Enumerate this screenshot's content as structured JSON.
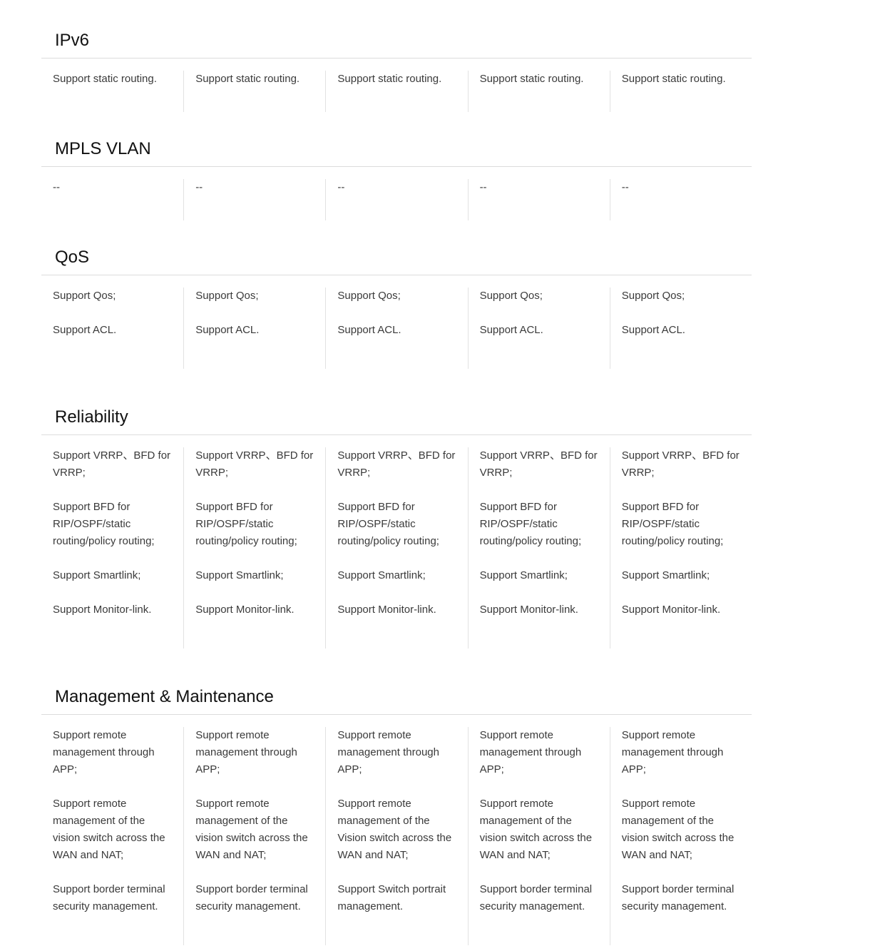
{
  "sections": [
    {
      "title": "IPv6",
      "columns": [
        [
          "Support static routing."
        ],
        [
          "Support static routing."
        ],
        [
          "Support static routing."
        ],
        [
          "Support static routing."
        ],
        [
          "Support static routing."
        ]
      ]
    },
    {
      "title": "MPLS VLAN",
      "columns": [
        [
          "--"
        ],
        [
          "--"
        ],
        [
          "--"
        ],
        [
          "--"
        ],
        [
          "--"
        ]
      ]
    },
    {
      "title": "QoS",
      "columns": [
        [
          "Support Qos;",
          "Support ACL."
        ],
        [
          "Support Qos;",
          "Support ACL."
        ],
        [
          "Support Qos;",
          "Support ACL."
        ],
        [
          "Support Qos;",
          "Support ACL."
        ],
        [
          "Support Qos;",
          "Support ACL."
        ]
      ]
    },
    {
      "title": "Reliability",
      "columns": [
        [
          "Support VRRP、BFD for VRRP;",
          "Support BFD for RIP/OSPF/static routing/policy routing;",
          "Support Smartlink;",
          "Support Monitor-link."
        ],
        [
          "Support VRRP、BFD for VRRP;",
          "Support BFD for RIP/OSPF/static routing/policy routing;",
          "Support Smartlink;",
          "Support Monitor-link."
        ],
        [
          "Support VRRP、BFD for VRRP;",
          "Support BFD for RIP/OSPF/static routing/policy routing;",
          "Support Smartlink;",
          "Support Monitor-link."
        ],
        [
          "Support VRRP、BFD for VRRP;",
          "Support BFD for RIP/OSPF/static routing/policy routing;",
          "Support Smartlink;",
          "Support Monitor-link."
        ],
        [
          "Support VRRP、BFD for VRRP;",
          "Support BFD for RIP/OSPF/static routing/policy routing;",
          "Support Smartlink;",
          "Support Monitor-link."
        ]
      ]
    },
    {
      "title": "Management & Maintenance",
      "columns": [
        [
          "Support remote management through APP;",
          "Support remote management of the vision switch across the WAN and NAT;",
          "Support border terminal security management."
        ],
        [
          "Support remote management through APP;",
          "Support remote management of the vision switch across the WAN and NAT;",
          "Support border terminal security management."
        ],
        [
          "Support remote management through APP;",
          "Support remote management of the Vision switch across the WAN and NAT;",
          "Support Switch portrait management."
        ],
        [
          "Support remote management through APP;",
          "Support remote management of the vision switch across the WAN and NAT;",
          "Support border terminal security management."
        ],
        [
          "Support remote management through APP;",
          "Support remote management of the vision switch across the WAN and NAT;",
          "Support border terminal security management."
        ]
      ]
    }
  ]
}
